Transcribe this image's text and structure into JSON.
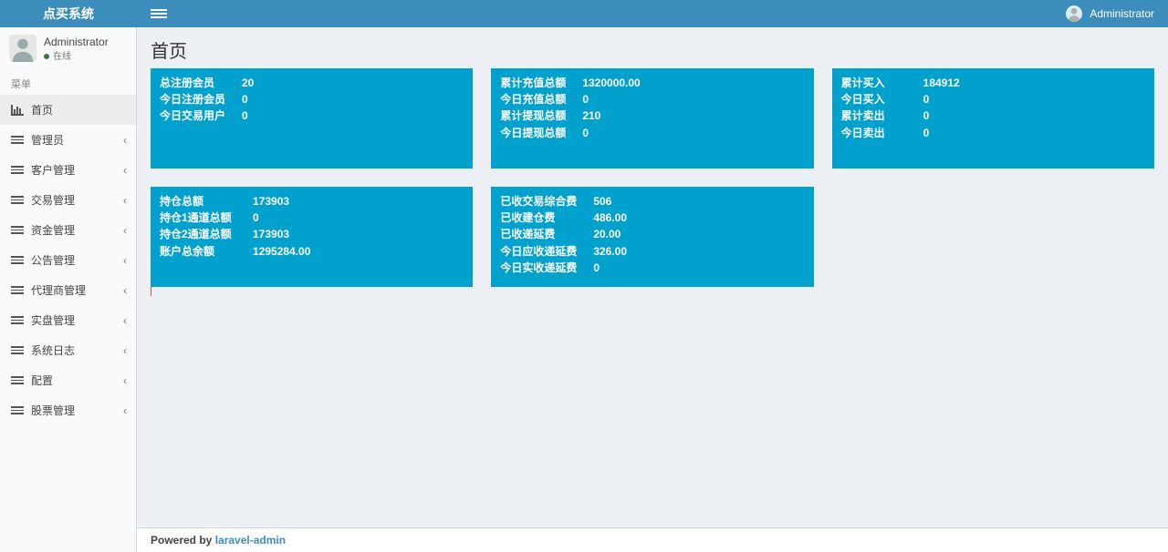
{
  "header": {
    "title": "点买系统",
    "user": "Administrator"
  },
  "user_panel": {
    "name": "Administrator",
    "status": "在线"
  },
  "menu_header": "菜单",
  "menu": [
    {
      "label": "首页",
      "icon": "chart",
      "active": true,
      "expandable": false
    },
    {
      "label": "管理员",
      "icon": "bars",
      "active": false,
      "expandable": true
    },
    {
      "label": "客户管理",
      "icon": "bars",
      "active": false,
      "expandable": true
    },
    {
      "label": "交易管理",
      "icon": "bars",
      "active": false,
      "expandable": true
    },
    {
      "label": "资金管理",
      "icon": "bars",
      "active": false,
      "expandable": true
    },
    {
      "label": "公告管理",
      "icon": "bars",
      "active": false,
      "expandable": true
    },
    {
      "label": "代理商管理",
      "icon": "bars",
      "active": false,
      "expandable": true
    },
    {
      "label": "实盘管理",
      "icon": "bars",
      "active": false,
      "expandable": true
    },
    {
      "label": "系统日志",
      "icon": "bars",
      "active": false,
      "expandable": true
    },
    {
      "label": "配置",
      "icon": "bars",
      "active": false,
      "expandable": true
    },
    {
      "label": "股票管理",
      "icon": "bars",
      "active": false,
      "expandable": true
    }
  ],
  "page_title": "首页",
  "cards": {
    "r0": {
      "c0": [
        {
          "k": "总注册会员",
          "v": "20"
        },
        {
          "k": "今日注册会员",
          "v": "0"
        },
        {
          "k": "今日交易用户",
          "v": "0"
        }
      ],
      "c1": [
        {
          "k": "累计充值总额",
          "v": "1320000.00"
        },
        {
          "k": "今日充值总额",
          "v": "0"
        },
        {
          "k": "累计提现总额",
          "v": "210"
        },
        {
          "k": "今日提现总额",
          "v": "0"
        }
      ],
      "c2": [
        {
          "k": "累计买入",
          "v": "184912"
        },
        {
          "k": "今日买入",
          "v": "0"
        },
        {
          "k": "累计卖出",
          "v": "0"
        },
        {
          "k": "今日卖出",
          "v": "0"
        }
      ]
    },
    "r1": {
      "c0": [
        {
          "k": "持仓总额",
          "v": "173903"
        },
        {
          "k": "持仓1通道总额",
          "v": "0"
        },
        {
          "k": "持仓2通道总额",
          "v": "173903"
        },
        {
          "k": "账户总余额",
          "v": "1295284.00"
        }
      ],
      "c1": [
        {
          "k": "已收交易综合费",
          "v": "506"
        },
        {
          "k": "已收建仓费",
          "v": "486.00"
        },
        {
          "k": "已收递延费",
          "v": "20.00"
        },
        {
          "k": "今日应收递延费",
          "v": "326.00"
        },
        {
          "k": "今日实收递延费",
          "v": "0"
        }
      ]
    }
  },
  "footer": {
    "prefix": "Powered by ",
    "link": "laravel-admin"
  }
}
